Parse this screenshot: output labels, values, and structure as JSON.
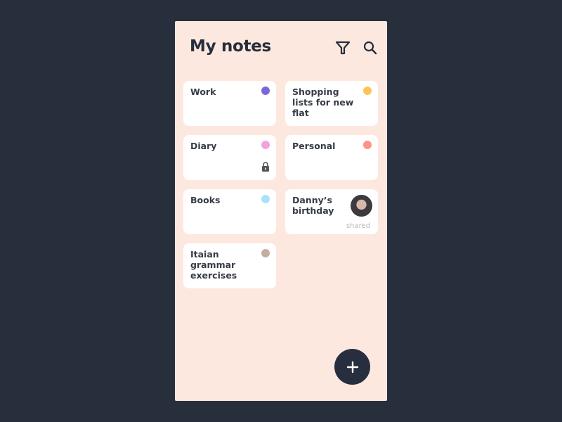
{
  "header": {
    "title": "My notes",
    "filter_icon": "filter-icon",
    "search_icon": "search-icon"
  },
  "notes": [
    {
      "title": "Work",
      "color": "#7b68d8",
      "col": 0,
      "row": 0
    },
    {
      "title": "Shopping lists for new flat",
      "color": "#fdc45a",
      "col": 1,
      "row": 0
    },
    {
      "title": "Diary",
      "color": "#f0a2e3",
      "col": 0,
      "row": 1,
      "locked": true
    },
    {
      "title": "Personal",
      "color": "#fc9484",
      "col": 1,
      "row": 1
    },
    {
      "title": "Books",
      "color": "#a8e3f9",
      "col": 0,
      "row": 2
    },
    {
      "title": "Danny’s birthday",
      "col": 1,
      "row": 2,
      "shared": true,
      "shared_label": "shared"
    },
    {
      "title": "Itaian grammar exercises",
      "color": "#c4aca2",
      "col": 0,
      "row": 3
    }
  ],
  "fab": {
    "icon": "plus-icon"
  }
}
